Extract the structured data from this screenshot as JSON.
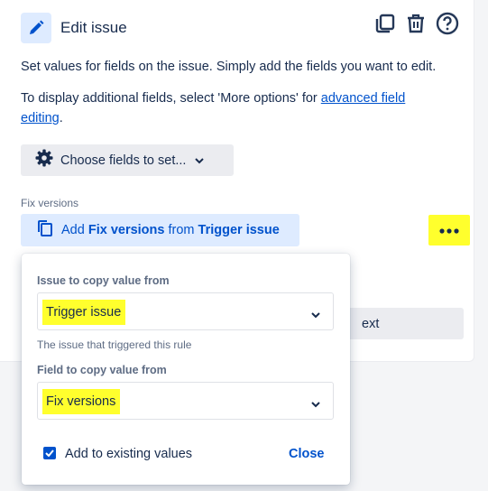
{
  "header": {
    "title": "Edit issue"
  },
  "description": {
    "line1": "Set values for fields on the issue. Simply add the fields you want to edit.",
    "line2_prefix": "To display additional fields, select 'More options' for ",
    "line2_link_part1": "advanced field",
    "line2_link_part2": "editing",
    "line2_suffix": "."
  },
  "choose_fields": {
    "label": "Choose fields to set..."
  },
  "field": {
    "label": "Fix versions",
    "add_prefix": "Add ",
    "add_field": "Fix versions",
    "add_mid": " from ",
    "add_source": "Trigger issue"
  },
  "next_button": {
    "label": "ext"
  },
  "popup": {
    "issue_label": "Issue to copy value from",
    "issue_value": "Trigger issue",
    "issue_helper": "The issue that triggered this rule",
    "field_label": "Field to copy value from",
    "field_value": "Fix versions",
    "checkbox_label": "Add to existing values",
    "checkbox_checked": true,
    "close_label": "Close"
  },
  "colors": {
    "accent": "#0052cc",
    "highlight": "#ffff2d",
    "text": "#172b4d",
    "subtle": "#5e6c84"
  }
}
